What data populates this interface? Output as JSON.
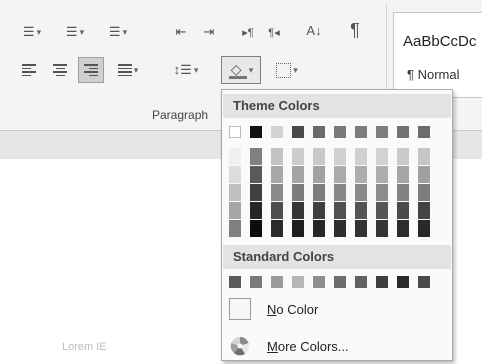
{
  "ribbon": {
    "group_label": "Paragraph",
    "styles": {
      "sample_text": "AaBbCcDc",
      "style_name": "¶ Normal"
    },
    "sort_label": "A↓",
    "pilcrow": "¶"
  },
  "dropdown": {
    "theme_header": "Theme Colors",
    "standard_header": "Standard Colors",
    "no_color": {
      "accel": "N",
      "rest": "o Color"
    },
    "more_colors": {
      "accel": "M",
      "rest": "ore Colors..."
    },
    "theme_top_row": [
      "#ffffff",
      "#111111",
      "#d4d4d4",
      "#4a4a4a",
      "#6a6a6a",
      "#7a7a7a",
      "#7c7c7c",
      "#7e7e7e",
      "#727272",
      "#6c6c6c"
    ],
    "theme_shades": [
      [
        "#f0f0f0",
        "#808080",
        "#c2c2c2",
        "#cccccc",
        "#c8c8c8",
        "#d0d0d0",
        "#d0d0d0",
        "#d2d2d2",
        "#cacaca",
        "#c6c6c6"
      ],
      [
        "#dcdcdc",
        "#595959",
        "#a8a8a8",
        "#a4a4a4",
        "#a2a2a2",
        "#ababab",
        "#adadad",
        "#aeaeae",
        "#a6a6a6",
        "#a0a0a0"
      ],
      [
        "#bfbfbf",
        "#404040",
        "#8a8a8a",
        "#7c7c7c",
        "#7c7c7c",
        "#888888",
        "#8a8a8a",
        "#8c8c8c",
        "#838383",
        "#7c7c7c"
      ],
      [
        "#a6a6a6",
        "#262626",
        "#4e4e4e",
        "#363636",
        "#3e3e3e",
        "#505050",
        "#545454",
        "#565656",
        "#4a4a4a",
        "#444444"
      ],
      [
        "#808080",
        "#0d0d0d",
        "#2a2a2a",
        "#1e1e1e",
        "#262626",
        "#2e2e2e",
        "#323232",
        "#343434",
        "#2c2c2c",
        "#282828"
      ]
    ],
    "standard_row": [
      "#5a5a5a",
      "#7a7a7a",
      "#9a9a9a",
      "#b6b6b6",
      "#8e8e8e",
      "#6e6e6e",
      "#626262",
      "#3e3e3e",
      "#2a2a2a",
      "#4a4a4a"
    ]
  },
  "faint_text": "Lorem  IE"
}
